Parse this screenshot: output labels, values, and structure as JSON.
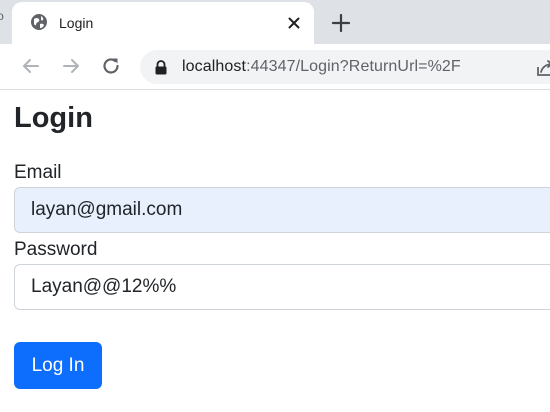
{
  "browser": {
    "tab": {
      "title": "Login",
      "favicon": "globe-icon",
      "close_icon": "close-icon"
    },
    "new_tab_icon": "plus-icon",
    "left_edge_glyph": "ρ",
    "toolbar": {
      "back_icon": "arrow-left-icon",
      "forward_icon": "arrow-right-icon",
      "reload_icon": "reload-icon"
    },
    "address_bar": {
      "lock_icon": "lock-icon",
      "url_host": "localhost",
      "url_rest": ":44347/Login?ReturnUrl=%2F",
      "share_icon": "share-icon"
    }
  },
  "page": {
    "title": "Login",
    "form": {
      "email_label": "Email",
      "email_value": "layan@gmail.com",
      "password_label": "Password",
      "password_value": "Layan@@12%%",
      "submit_label": "Log In"
    }
  },
  "colors": {
    "primary_button": "#0d6efd",
    "autofill_background": "#e8f0fe",
    "tabstrip": "#dee1e6",
    "omnibox": "#f1f3f4"
  }
}
